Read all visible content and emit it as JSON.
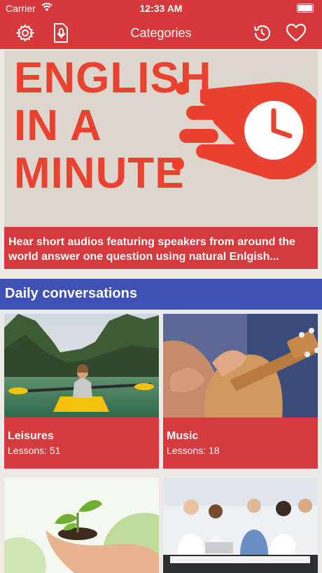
{
  "status_bar": {
    "carrier": "Carrier",
    "time": "12:33 AM"
  },
  "nav": {
    "title": "Categories",
    "icons": [
      "gear-icon",
      "audio-file-icon",
      "history-icon",
      "heart-icon"
    ]
  },
  "banner": {
    "headline_lines": [
      "ENGLISH",
      "IN A",
      "MINUTE"
    ],
    "caption": "Hear short audios featuring speakers from around the world answer one question using natural Enlgish..."
  },
  "section": {
    "title": "Daily conversations"
  },
  "categories": [
    {
      "name": "Leisures",
      "lessons": "Lessons: 51"
    },
    {
      "name": "Music",
      "lessons": "Lessons: 18"
    }
  ],
  "colors": {
    "primary": "#d5393c",
    "section": "#3f51b5",
    "banner_text": "#ea4230"
  }
}
